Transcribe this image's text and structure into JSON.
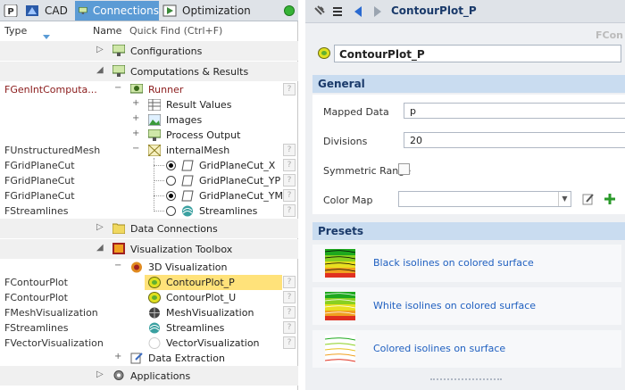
{
  "tabs": {
    "p": "P",
    "cad": "CAD",
    "connections": "Connections",
    "optimization": "Optimization"
  },
  "columns": {
    "type": "Type",
    "name": "Name",
    "quickfind": "Quick Find (Ctrl+F)"
  },
  "tree": {
    "configurations": "Configurations",
    "computations": "Computations & Results",
    "runner": {
      "type": "FGenIntComputa...",
      "label": "Runner"
    },
    "result_values": "Result Values",
    "images": "Images",
    "process_output": "Process Output",
    "internal_mesh": {
      "type": "FUnstructuredMesh",
      "label": "internalMesh"
    },
    "cut_x": {
      "type": "FGridPlaneCut",
      "label": "GridPlaneCut_X"
    },
    "cut_yp": {
      "type": "FGridPlaneCut",
      "label": "GridPlaneCut_YP"
    },
    "cut_ym": {
      "type": "FGridPlaneCut",
      "label": "GridPlaneCut_YM"
    },
    "streamlines1": {
      "type": "FStreamlines",
      "label": "Streamlines"
    },
    "data_connections": "Data Connections",
    "viz_toolbox": "Visualization Toolbox",
    "viz3d": "3D Visualization",
    "contour_p": {
      "type": "FContourPlot",
      "label": "ContourPlot_P"
    },
    "contour_u": {
      "type": "FContourPlot",
      "label": "ContourPlot_U"
    },
    "meshviz": {
      "type": "FMeshVisualization",
      "label": "MeshVisualization"
    },
    "streamlines2": {
      "type": "FStreamlines",
      "label": "Streamlines"
    },
    "vectorviz": {
      "type": "FVectorVisualization",
      "label": "VectorVisualization"
    },
    "data_extraction": "Data Extraction",
    "applications": "Applications",
    "help": "?"
  },
  "right": {
    "title": "ContourPlot_P",
    "corner": "FCon",
    "name_value": "ContourPlot_P",
    "general": {
      "header": "General",
      "mapped_data_label": "Mapped Data",
      "mapped_data_value": "p",
      "divisions_label": "Divisions",
      "divisions_value": "20",
      "symmetric_label": "Symmetric Range",
      "colormap_label": "Color Map"
    },
    "presets": {
      "header": "Presets",
      "items": [
        "Black isolines on colored surface",
        "White isolines on colored surface",
        "Colored isolines on surface"
      ]
    }
  },
  "colors": {
    "accent": "#5b9bd5",
    "selected": "#ffe27a",
    "section": "#c9dcf0",
    "link": "#2060c0"
  }
}
